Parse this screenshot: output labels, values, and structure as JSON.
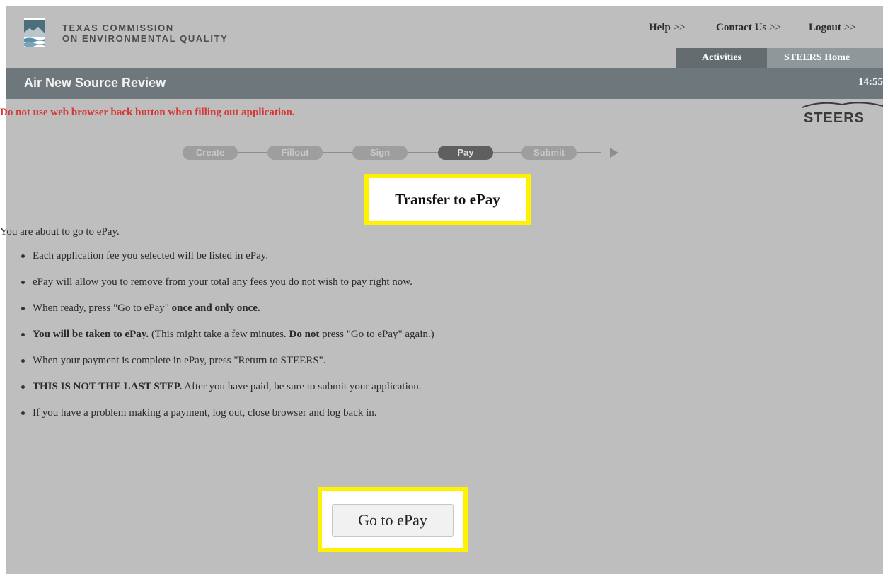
{
  "header": {
    "logo_line1": "Texas Commission",
    "logo_line2": "on Environmental Quality",
    "links": [
      {
        "label": "Help",
        "suffix": ">>"
      },
      {
        "label": "Contact Us",
        "suffix": ">>"
      },
      {
        "label": "Logout",
        "suffix": ">>"
      }
    ],
    "tabs": [
      "Activities",
      "STEERS Home"
    ]
  },
  "titlebar": {
    "title": "Air New Source Review",
    "clock": "14:55"
  },
  "warning": "Do not use web browser back button when filling out application.",
  "brand_logo_text": "STEERS",
  "steps": [
    {
      "label": "Create",
      "active": false
    },
    {
      "label": "Fillout",
      "active": false
    },
    {
      "label": "Sign",
      "active": false
    },
    {
      "label": "Pay",
      "active": true
    },
    {
      "label": "Submit",
      "active": false
    }
  ],
  "page_heading": "Transfer to ePay",
  "intro": "You are about to go to ePay.",
  "bullets": [
    {
      "parts": [
        {
          "t": "Each application fee you selected will be listed in ePay.",
          "b": false
        }
      ]
    },
    {
      "parts": [
        {
          "t": "ePay will allow you to remove from your total any fees you do not wish to pay right now.",
          "b": false
        }
      ]
    },
    {
      "parts": [
        {
          "t": "When ready, press \"Go to ePay\" ",
          "b": false
        },
        {
          "t": "once and only once.",
          "b": true
        }
      ]
    },
    {
      "parts": [
        {
          "t": "You will be taken to ePay.",
          "b": true
        },
        {
          "t": " (This might take a few minutes. ",
          "b": false
        },
        {
          "t": "Do not",
          "b": true
        },
        {
          "t": " press \"Go to ePay\" again.)",
          "b": false
        }
      ]
    },
    {
      "parts": [
        {
          "t": "When your payment is complete in ePay, press \"Return to STEERS\".",
          "b": false
        }
      ]
    },
    {
      "parts": [
        {
          "t": "THIS IS NOT THE LAST STEP.",
          "b": true
        },
        {
          "t": " After you have paid, be sure to submit your application.",
          "b": false
        }
      ]
    },
    {
      "parts": [
        {
          "t": "If you have a problem making a payment, log out, close browser and log back in.",
          "b": false
        }
      ]
    }
  ],
  "go_button_label": "Go to ePay",
  "colors": {
    "page_bg": "#bebebe",
    "titlebar": "#6e777c",
    "warning": "#d63636",
    "highlight": "#fff200",
    "step_active": "#5f5f5f",
    "step_inactive": "#9e9e9e"
  }
}
